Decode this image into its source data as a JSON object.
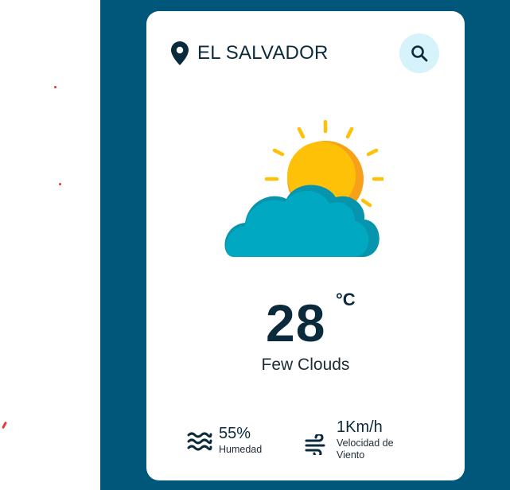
{
  "location": {
    "city": "EL SALVADOR"
  },
  "search": {
    "icon": "search-icon"
  },
  "weather": {
    "icon": "partly-cloudy-icon",
    "temperature": "28",
    "unit": "°C",
    "condition": "Few Clouds"
  },
  "stats": {
    "humidity": {
      "value": "55%",
      "label": "Humedad",
      "icon": "waves-icon"
    },
    "wind": {
      "value": "1Km/h",
      "label": "Velocidad de Viento",
      "icon": "wind-icon"
    }
  },
  "colors": {
    "background": "#00577a",
    "card": "#ffffff",
    "text": "#0b2a3c",
    "search_bg": "#d6f3fb",
    "sun": "#ffb703",
    "cloud": "#00a8c1"
  }
}
